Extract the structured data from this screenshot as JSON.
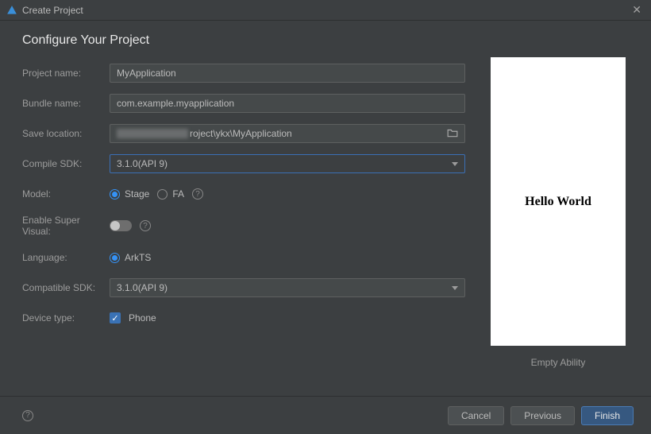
{
  "window": {
    "title": "Create Project"
  },
  "page": {
    "heading": "Configure Your Project"
  },
  "form": {
    "project_name": {
      "label": "Project name:",
      "value": "MyApplication"
    },
    "bundle_name": {
      "label": "Bundle name:",
      "value": "com.example.myapplication"
    },
    "save_location": {
      "label": "Save location:",
      "value_suffix": "roject\\ykx\\MyApplication"
    },
    "compile_sdk": {
      "label": "Compile SDK:",
      "value": "3.1.0(API 9)"
    },
    "model": {
      "label": "Model:",
      "options": [
        {
          "id": "stage",
          "label": "Stage",
          "selected": true
        },
        {
          "id": "fa",
          "label": "FA",
          "selected": false
        }
      ]
    },
    "enable_super_visual": {
      "label": "Enable Super Visual:",
      "value": false
    },
    "language": {
      "label": "Language:",
      "options": [
        {
          "id": "arkts",
          "label": "ArkTS",
          "selected": true
        }
      ]
    },
    "compatible_sdk": {
      "label": "Compatible SDK:",
      "value": "3.1.0(API 9)"
    },
    "device_type": {
      "label": "Device type:",
      "options": [
        {
          "id": "phone",
          "label": "Phone",
          "checked": true
        }
      ]
    }
  },
  "preview": {
    "text": "Hello World",
    "caption": "Empty Ability"
  },
  "footer": {
    "cancel": "Cancel",
    "previous": "Previous",
    "finish": "Finish"
  }
}
